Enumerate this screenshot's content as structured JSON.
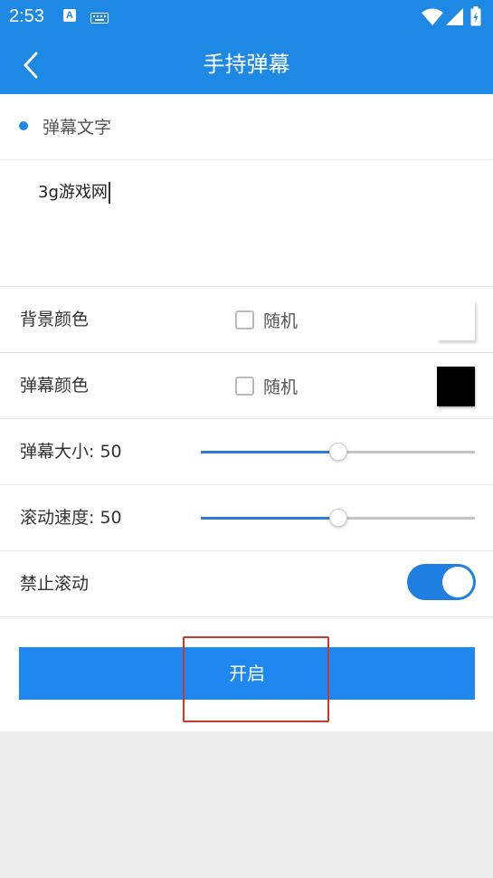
{
  "status_bar": {
    "time": "2:53",
    "notification_icon_letter": "A",
    "icons": [
      "a-icon",
      "keyboard-icon",
      "wifi-icon",
      "signal-icon",
      "battery-icon"
    ]
  },
  "app_bar": {
    "title": "手持弹幕",
    "back_icon": "chevron-left-icon",
    "background_color": "#1e88e5"
  },
  "text_section": {
    "title": "弹幕文字",
    "value": "3g游戏网"
  },
  "settings": {
    "background_color": {
      "label": "背景颜色",
      "random_label": "随机",
      "random_checked": false,
      "swatch_color": "#ffffff"
    },
    "danmaku_color": {
      "label": "弹幕颜色",
      "random_label": "随机",
      "random_checked": false,
      "swatch_color": "#000000"
    },
    "danmaku_size": {
      "label": "弹幕大小: 50",
      "value": 50,
      "max": 100
    },
    "scroll_speed": {
      "label": "滚动速度: 50",
      "value": 50,
      "max": 100
    },
    "disable_scroll": {
      "label": "禁止滚动",
      "enabled": true
    }
  },
  "start_button": {
    "label": "开启",
    "color": "#1e88f0"
  },
  "accent_color": "#1e88e5",
  "highlight_color": "#c8382c"
}
